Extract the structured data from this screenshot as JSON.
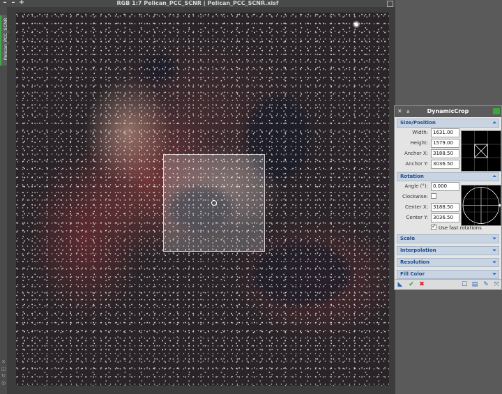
{
  "image_window": {
    "title": "RGB 1:7 Pelican_PCC_SCNR | Pelican_PCC_SCNR.xisf",
    "side_tab_label": "Pelican_PCC_SCNR",
    "controls": [
      "–",
      "–",
      "+"
    ]
  },
  "panel": {
    "title": "DynamicCrop",
    "sections": {
      "size_position": "Size/Position",
      "rotation": "Rotation",
      "scale": "Scale",
      "interpolation": "Interpolation",
      "resolution": "Resolution",
      "fill_color": "Fill Color"
    },
    "size_position": {
      "width_label": "Width:",
      "width_value": "1631.00",
      "height_label": "Height:",
      "height_value": "1579.00",
      "anchor_x_label": "Anchor X:",
      "anchor_x_value": "3188.50",
      "anchor_y_label": "Anchor Y:",
      "anchor_y_value": "3036.50"
    },
    "rotation": {
      "angle_label": "Angle (°):",
      "angle_value": "0.000",
      "clockwise_label": "Clockwise:",
      "clockwise_checked": false,
      "center_x_label": "Center X:",
      "center_x_value": "3188.50",
      "center_y_label": "Center Y:",
      "center_y_value": "3036.50",
      "fast_rotations_label": "Use fast rotations",
      "fast_rotations_checked": true
    }
  },
  "colors": {
    "section_header_text": "#1f4d86",
    "execute_check": "#2f9a2f",
    "cancel_x": "#d02020"
  }
}
